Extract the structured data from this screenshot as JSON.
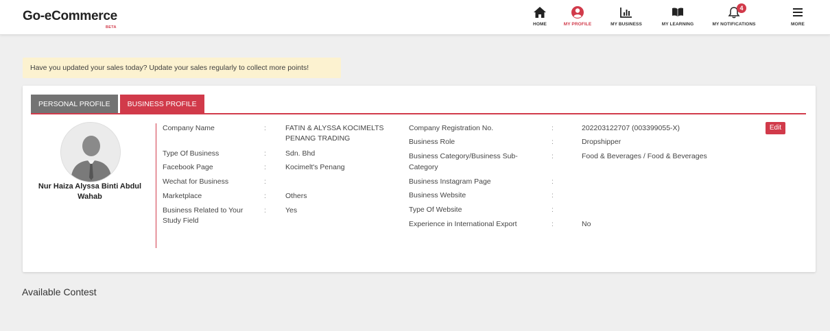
{
  "header": {
    "brand": "Go-eCommerce",
    "beta": "BETA",
    "nav": {
      "home": "HOME",
      "my_profile": "MY PROFILE",
      "my_business": "MY BUSINESS",
      "my_learning": "MY LEARNING",
      "my_notifications": "MY NOTIFICATIONS",
      "more": "MORE"
    },
    "notification_count": "4",
    "accent_color": "#d13a4a"
  },
  "alert": {
    "text": "Have you updated your sales today? Update your sales regularly to collect more points!"
  },
  "profile": {
    "tabs": {
      "personal": "PERSONAL PROFILE",
      "business": "BUSINESS PROFILE"
    },
    "name_line1": "Nur Haiza Alyssa Binti Abdul",
    "name_line2": "Wahab",
    "colon": ":",
    "edit_label": "Edit",
    "left_fields": {
      "company_name": {
        "label": "Company Name",
        "value_line1": "FATIN & ALYSSA KOCIMELTS",
        "value_line2": "PENANG TRADING"
      },
      "type_of_business": {
        "label": "Type Of Business",
        "value": "Sdn. Bhd"
      },
      "facebook_page": {
        "label": "Facebook Page",
        "value": "Kocimelt's Penang"
      },
      "wechat": {
        "label": "Wechat for Business",
        "value": ""
      },
      "marketplace": {
        "label": "Marketplace",
        "value": "Others"
      },
      "related_study": {
        "label_line1": "Business Related to Your",
        "label_line2": "Study Field",
        "value": "Yes"
      }
    },
    "right_fields": {
      "registration_no": {
        "label": "Company Registration No.",
        "value": "202203122707 (003399055-X)"
      },
      "business_role": {
        "label": "Business Role",
        "value": "Dropshipper"
      },
      "category": {
        "label_line1": "Business Category/Business Sub-",
        "label_line2": "Category",
        "value": "Food & Beverages / Food & Beverages"
      },
      "instagram": {
        "label": "Business Instagram Page",
        "value": ""
      },
      "website": {
        "label": "Business Website",
        "value": ""
      },
      "website_type": {
        "label": "Type Of Website",
        "value": ""
      },
      "export_experience": {
        "label": "Experience in International Export",
        "value": "No"
      }
    }
  },
  "contest": {
    "title": "Available Contest"
  }
}
